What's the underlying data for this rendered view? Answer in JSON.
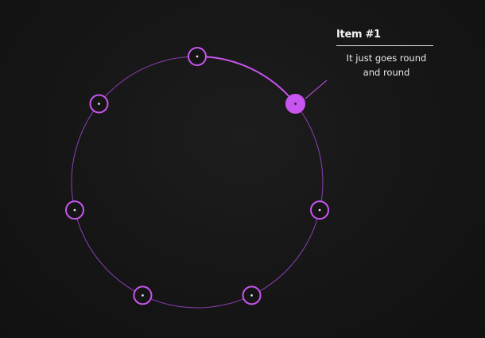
{
  "accent_color": "#c855f0",
  "ring_color": "#8b3fb3",
  "background_color": "#151515",
  "items": [
    {
      "index": 0,
      "active": false
    },
    {
      "index": 1,
      "active": true
    },
    {
      "index": 2,
      "active": false
    },
    {
      "index": 3,
      "active": false
    },
    {
      "index": 4,
      "active": false
    },
    {
      "index": 5,
      "active": false
    },
    {
      "index": 6,
      "active": false
    }
  ],
  "progress_fraction": 0.142857,
  "tooltip": {
    "title": "Item #1",
    "body_line1": "It just goes round",
    "body_line2": "and round"
  }
}
